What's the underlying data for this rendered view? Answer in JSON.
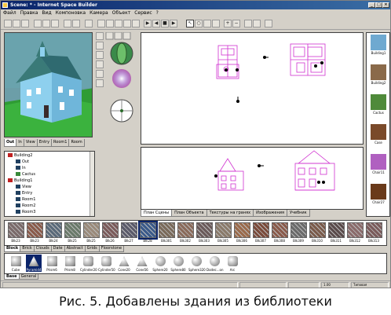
{
  "window": {
    "title": "Scene: * - Internet Space Builder"
  },
  "menu": [
    "Файл",
    "Правка",
    "Вид",
    "Компоновка",
    "Камера",
    "Объект",
    "Сервис",
    "?"
  ],
  "view_tabs": [
    "Out",
    "In",
    "View",
    "Entry",
    "Room1",
    "Room"
  ],
  "scene_tree": [
    {
      "label": "Building2",
      "level": 0,
      "icon": "red"
    },
    {
      "label": "Out",
      "level": 1,
      "icon": "cam"
    },
    {
      "label": "In",
      "level": 1,
      "icon": "cam"
    },
    {
      "label": "Cactus",
      "level": 1,
      "icon": "obj"
    },
    {
      "label": "Building1",
      "level": 0,
      "icon": "red"
    },
    {
      "label": "View",
      "level": 1,
      "icon": "cam"
    },
    {
      "label": "Entry",
      "level": 1,
      "icon": "cam"
    },
    {
      "label": "Room1",
      "level": 1,
      "icon": "cam"
    },
    {
      "label": "Room2",
      "level": 1,
      "icon": "cam"
    },
    {
      "label": "Room3",
      "level": 1,
      "icon": "cam"
    }
  ],
  "layout_tabs": [
    "План Сцены",
    "План Объекта",
    "Текстуры на гранях",
    "Изображения",
    "Учебник"
  ],
  "library": [
    {
      "label": "Building1",
      "color": "#6fa9d0"
    },
    {
      "label": "Building2",
      "color": "#8a6a4a"
    },
    {
      "label": "Cactus",
      "color": "#4f8a3a"
    },
    {
      "label": "Case",
      "color": "#7a4a2a"
    },
    {
      "label": "Chair11",
      "color": "#b060c0"
    },
    {
      "label": "Chair27",
      "color": "#6a3a1a"
    }
  ],
  "materials": [
    {
      "label": "Blk23",
      "color": "#7a6a6a"
    },
    {
      "label": "Blk23",
      "color": "#8a5a4a"
    },
    {
      "label": "Blk24",
      "color": "#5a6a7a"
    },
    {
      "label": "Blk25",
      "color": "#6a7a6a"
    },
    {
      "label": "Blk25",
      "color": "#9a8a7a"
    },
    {
      "label": "Blk26",
      "color": "#7a5a5a"
    },
    {
      "label": "Blk27",
      "color": "#5a5a6a"
    },
    {
      "label": "Blk28",
      "color": "#3a5a8a"
    },
    {
      "label": "Blk301",
      "color": "#7a6a5a"
    },
    {
      "label": "Blk302",
      "color": "#8a6a5a"
    },
    {
      "label": "Blk303",
      "color": "#6a5a5a"
    },
    {
      "label": "Blk305",
      "color": "#8a7a6a"
    },
    {
      "label": "Blk306",
      "color": "#9a6a4a"
    },
    {
      "label": "Blk307",
      "color": "#7a4a3a"
    },
    {
      "label": "Blk308",
      "color": "#8a5a4a"
    },
    {
      "label": "Blk309",
      "color": "#6a6a6a"
    },
    {
      "label": "Blk310",
      "color": "#7a5a4a"
    },
    {
      "label": "Blk311",
      "color": "#5a4a4a"
    },
    {
      "label": "Blk312",
      "color": "#8a6a6a"
    },
    {
      "label": "Blk313",
      "color": "#7a5a5a"
    }
  ],
  "material_tabs": [
    "Block",
    "Brick",
    "Clouds",
    "Date",
    "Abstract",
    "Grids",
    "Floorstone"
  ],
  "primitives": [
    "Cube",
    "Pyramid4",
    "Prism6",
    "Prism8",
    "Cylinder20",
    "Cylinder50",
    "Cone20",
    "Cone56",
    "Sphere20",
    "Sphere80",
    "Sphere320",
    "Dodec...on",
    "Arc"
  ],
  "primitive_tabs": [
    "Base",
    "General"
  ],
  "status": {
    "zoom": "1.00",
    "mode": "Типовая"
  },
  "caption": "Рис. 5. Добавлены здания из библиотеки"
}
